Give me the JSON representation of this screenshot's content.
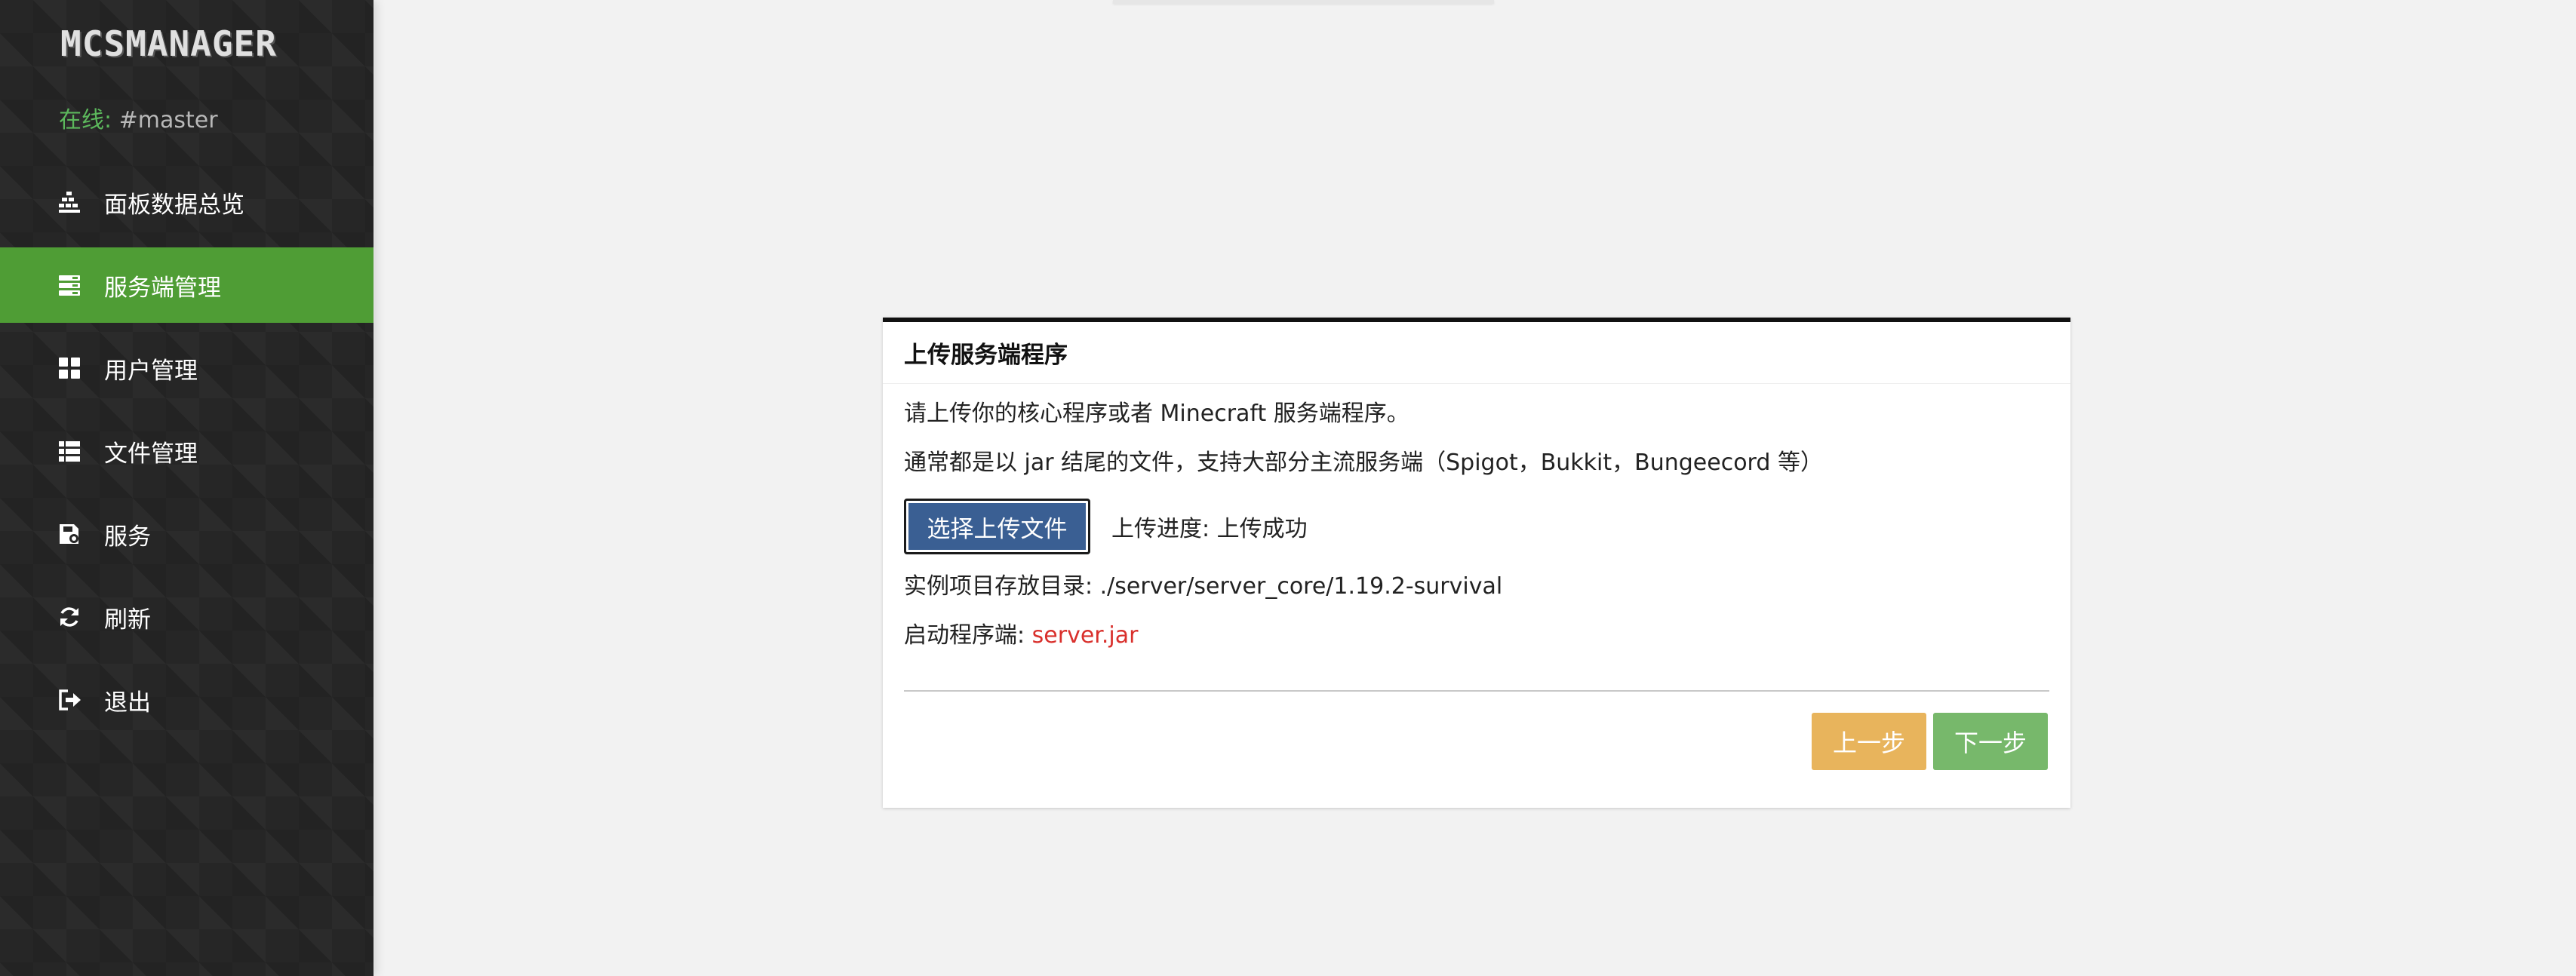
{
  "sidebar": {
    "logo": "MCSMANAGER",
    "status_label": "在线:",
    "status_host": "#master",
    "items": [
      {
        "label": "面板数据总览",
        "icon": "dashboard-icon",
        "active": false
      },
      {
        "label": "服务端管理",
        "icon": "server-icon",
        "active": true
      },
      {
        "label": "用户管理",
        "icon": "grid-icon",
        "active": false
      },
      {
        "label": "文件管理",
        "icon": "list-icon",
        "active": false
      },
      {
        "label": "服务",
        "icon": "service-icon",
        "active": false
      },
      {
        "label": "刷新",
        "icon": "refresh-icon",
        "active": false
      },
      {
        "label": "退出",
        "icon": "logout-icon",
        "active": false
      }
    ]
  },
  "dialog": {
    "title": "上传服务端程序",
    "instruction": "请上传你的核心程序或者 Minecraft 服务端程序。",
    "hint": "通常都是以 jar 结尾的文件，支持大部分主流服务端（Spigot，Bukkit，Bungeecord 等）",
    "upload_button": "选择上传文件",
    "progress_text": "上传进度: 上传成功",
    "directory_text": "实例项目存放目录: ./server/server_core/1.19.2-survival",
    "launcher_label": "启动程序端: ",
    "launcher_file": "server.jar",
    "prev_button": "上一步",
    "next_button": "下一步"
  },
  "colors": {
    "sidebar_bg": "#262626",
    "active_item": "#4f9d35",
    "status_online": "#5cb85c",
    "upload_button": "#3a5f93",
    "prev_button": "#e8b45c",
    "next_button": "#77b86b",
    "file_highlight": "#d9302c"
  }
}
